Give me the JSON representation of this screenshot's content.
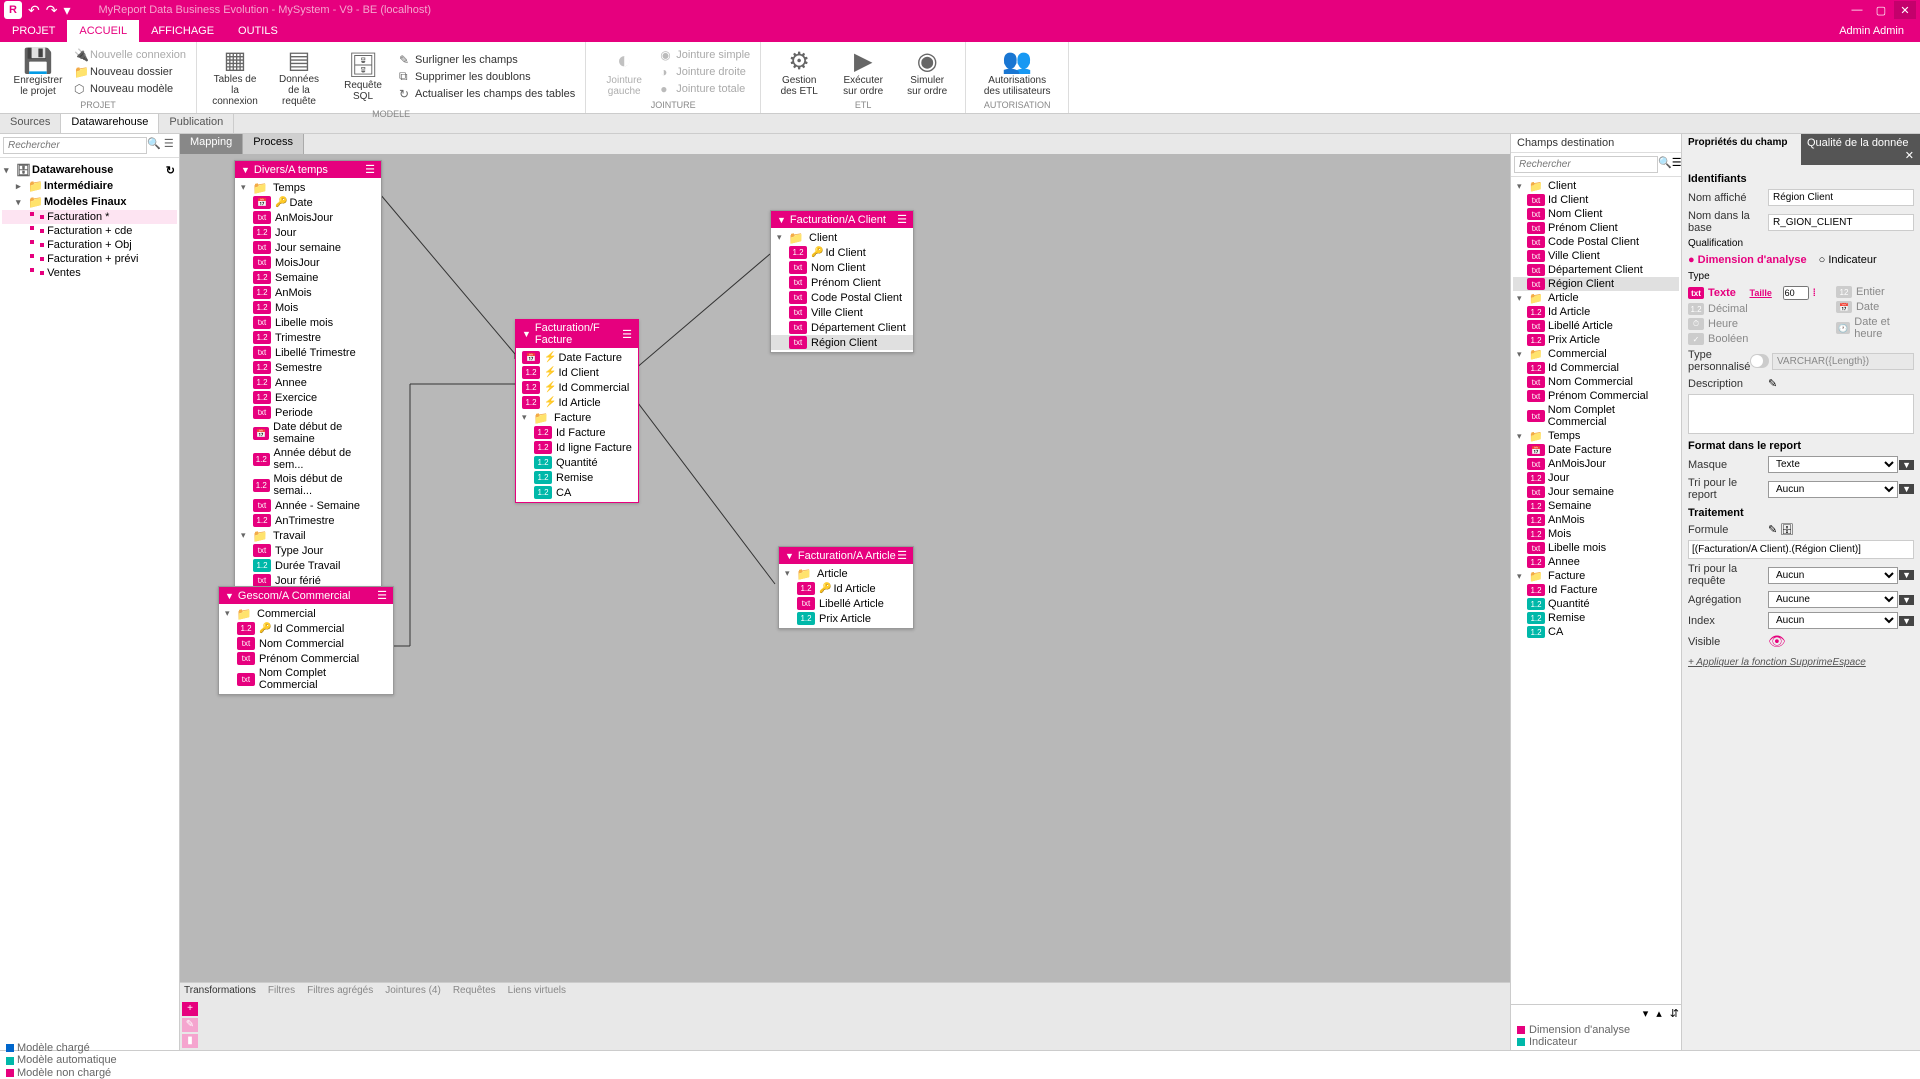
{
  "title": "MyReport Data Business Evolution - MySystem - V9 - BE (localhost)",
  "user": "Admin Admin",
  "menu": {
    "projet": "PROJET",
    "accueil": "ACCUEIL",
    "affichage": "AFFICHAGE",
    "outils": "OUTILS"
  },
  "ribbon": {
    "enregistrer": "Enregistrer le projet",
    "nouvelle_connexion": "Nouvelle connexion",
    "nouveau_dossier": "Nouveau dossier",
    "nouveau_modele": "Nouveau modèle",
    "tables": "Tables de la connexion",
    "donnees": "Données de la requête",
    "requete": "Requête SQL",
    "surligner": "Surligner les champs",
    "supprimer": "Supprimer les doublons",
    "actualiser": "Actualiser les champs des tables",
    "jointure_gauche": "Jointure gauche",
    "jointure_simple": "Jointure simple",
    "jointure_droite": "Jointure droite",
    "jointure_totale": "Jointure totale",
    "gestion_etl": "Gestion des ETL",
    "executer": "Exécuter sur ordre",
    "simuler": "Simuler sur ordre",
    "autorisations": "Autorisations des utilisateurs",
    "grp_projet": "PROJET",
    "grp_modele": "MODELE",
    "grp_jointure": "JOINTURE",
    "grp_etl": "ETL",
    "grp_auth": "AUTORISATION"
  },
  "doctabs": {
    "sources": "Sources",
    "dw": "Datawarehouse",
    "pub": "Publication"
  },
  "search_ph": "Rechercher",
  "tree": {
    "root": "Datawarehouse",
    "intermediaire": "Intermédiaire",
    "modeles": "Modèles Finaux",
    "items": [
      "Facturation *",
      "Facturation + cde",
      "Facturation + Obj",
      "Facturation + prévi",
      "Ventes"
    ]
  },
  "canvas_tabs": {
    "mapping": "Mapping",
    "process": "Process"
  },
  "nodes": {
    "temps": {
      "title": "Divers/A temps",
      "folder": "Temps",
      "fields": [
        "Date",
        "AnMoisJour",
        "Jour",
        "Jour semaine",
        "MoisJour",
        "Semaine",
        "AnMois",
        "Mois",
        "Libelle mois",
        "Trimestre",
        "Libellé Trimestre",
        "Semestre",
        "Annee",
        "Exercice",
        "Periode",
        "Date début de semaine",
        "Année début de sem...",
        "Mois début de semai...",
        "Année - Semaine",
        "AnTrimestre"
      ],
      "folder2": "Travail",
      "fields2": [
        "Type Jour",
        "Durée Travail",
        "Jour férié"
      ]
    },
    "commercial": {
      "title": "Gescom/A Commercial",
      "folder": "Commercial",
      "fields": [
        "Id Commercial",
        "Nom Commercial",
        "Prénom Commercial",
        "Nom Complet Commercial"
      ]
    },
    "facture": {
      "title": "Facturation/F Facture",
      "fields": [
        "Date Facture",
        "Id Client",
        "Id Commercial",
        "Id Article"
      ],
      "folder": "Facture",
      "fields2": [
        "Id Facture",
        "Id ligne Facture",
        "Quantité",
        "Remise",
        "CA"
      ]
    },
    "client": {
      "title": "Facturation/A Client",
      "folder": "Client",
      "fields": [
        "Id Client",
        "Nom Client",
        "Prénom Client",
        "Code Postal Client",
        "Ville Client",
        "Département Client",
        "Région Client"
      ]
    },
    "article": {
      "title": "Facturation/A Article",
      "folder": "Article",
      "fields": [
        "Id Article",
        "Libellé Article",
        "Prix Article"
      ]
    }
  },
  "bottom_tabs": {
    "trans": "Transformations",
    "filtres": "Filtres",
    "filtres_ag": "Filtres agrégés",
    "jointures": "Jointures (4)",
    "requetes": "Requêtes",
    "liens": "Liens virtuels"
  },
  "dest": {
    "title": "Champs destination",
    "groups": [
      {
        "name": "Client",
        "items": [
          "Id Client",
          "Nom Client",
          "Prénom Client",
          "Code Postal Client",
          "Ville Client",
          "Département Client",
          "Région Client"
        ]
      },
      {
        "name": "Article",
        "items": [
          "Id Article",
          "Libellé Article",
          "Prix Article"
        ]
      },
      {
        "name": "Commercial",
        "items": [
          "Id Commercial",
          "Nom Commercial",
          "Prénom Commercial",
          "Nom Complet Commercial"
        ]
      },
      {
        "name": "Temps",
        "items": [
          "Date Facture",
          "AnMoisJour",
          "Jour",
          "Jour semaine",
          "Semaine",
          "AnMois",
          "Mois",
          "Libelle mois",
          "Annee"
        ]
      },
      {
        "name": "Facture",
        "items": [
          "Id Facture",
          "Quantité",
          "Remise",
          "CA"
        ]
      }
    ],
    "legend": {
      "dim": "Dimension d'analyse",
      "ind": "Indicateur"
    }
  },
  "props": {
    "tab1": "Propriétés du champ",
    "tab2": "Qualité de la donnée",
    "identifiants": "Identifiants",
    "nom_affiche_lbl": "Nom affiché",
    "nom_affiche": "Région Client",
    "nom_base_lbl": "Nom dans la base",
    "nom_base": "R_GION_CLIENT",
    "qualif": "Qualification",
    "dim": "Dimension d'analyse",
    "ind": "Indicateur",
    "type": "Type",
    "texte": "Texte",
    "taille": "Taille",
    "taille_val": "60",
    "decimal": "Décimal",
    "heure": "Heure",
    "booleen": "Booléen",
    "entier": "Entier",
    "date": "Date",
    "datetime": "Date et heure",
    "type_perso": "Type personnalisé",
    "varchar": "VARCHAR({Length})",
    "desc": "Description",
    "format": "Format dans le report",
    "masque": "Masque",
    "masque_val": "Texte",
    "tri_report": "Tri pour le report",
    "aucun": "Aucun",
    "traitement": "Traitement",
    "formule": "Formule",
    "formule_val": "[(Facturation/A Client).(Région Client)]",
    "tri_requete": "Tri pour la requête",
    "agregation": "Agrégation",
    "aucune": "Aucune",
    "index": "Index",
    "visible": "Visible",
    "supprime": "+ Appliquer la fonction SupprimeEspace"
  },
  "legend": {
    "charge": "Modèle chargé",
    "auto": "Modèle automatique",
    "non": "Modèle non chargé"
  }
}
